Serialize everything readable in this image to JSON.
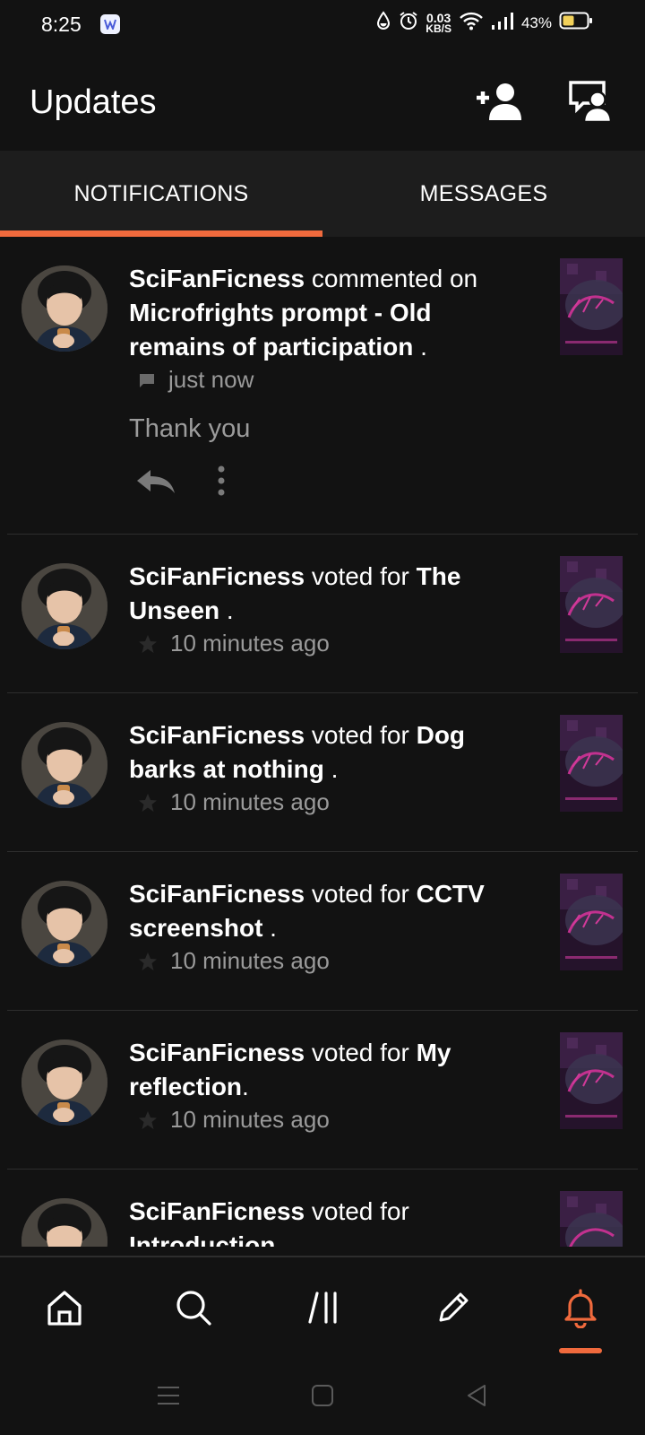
{
  "status_bar": {
    "time": "8:25",
    "speed_value": "0.03",
    "speed_unit": "KB/S",
    "battery": "43%"
  },
  "app_bar": {
    "title": "Updates",
    "icons": [
      "add-user-icon",
      "messages-icon"
    ]
  },
  "tabs": [
    {
      "label": "NOTIFICATIONS",
      "selected": true
    },
    {
      "label": "MESSAGES",
      "selected": false
    }
  ],
  "notifications": [
    {
      "user": "SciFanFicness",
      "action": " commented on ",
      "target": "Microfrights prompt - Old remains of participation",
      "suffix": " .",
      "time": "just now",
      "meta_icon": "comment-icon",
      "comment": "Thank you"
    },
    {
      "user": "SciFanFicness",
      "action": " voted for ",
      "target": "The Unseen",
      "suffix": " .",
      "time": "10 minutes ago",
      "meta_icon": "star-icon"
    },
    {
      "user": "SciFanFicness",
      "action": " voted for ",
      "target": "Dog barks at nothing",
      "suffix": " .",
      "time": "10 minutes ago",
      "meta_icon": "star-icon"
    },
    {
      "user": "SciFanFicness",
      "action": " voted for ",
      "target": "CCTV screenshot",
      "suffix": " .",
      "time": "10 minutes ago",
      "meta_icon": "star-icon"
    },
    {
      "user": "SciFanFicness",
      "action": " voted for ",
      "target": "My reflection",
      "suffix": ".",
      "time": "10 minutes ago",
      "meta_icon": "star-icon"
    },
    {
      "user": "SciFanFicness",
      "action": " voted for ",
      "target": "Introduction",
      "suffix": "",
      "time": "",
      "meta_icon": "star-icon"
    }
  ],
  "bottom_nav": {
    "items": [
      "home-icon",
      "search-icon",
      "library-icon",
      "write-icon",
      "notifications-bell-icon"
    ],
    "active": "notifications-bell-icon"
  },
  "colors": {
    "accent": "#f06a3d",
    "background": "#121212",
    "tabs_background": "#1d1d1d",
    "muted_text": "#9a9a9a"
  }
}
